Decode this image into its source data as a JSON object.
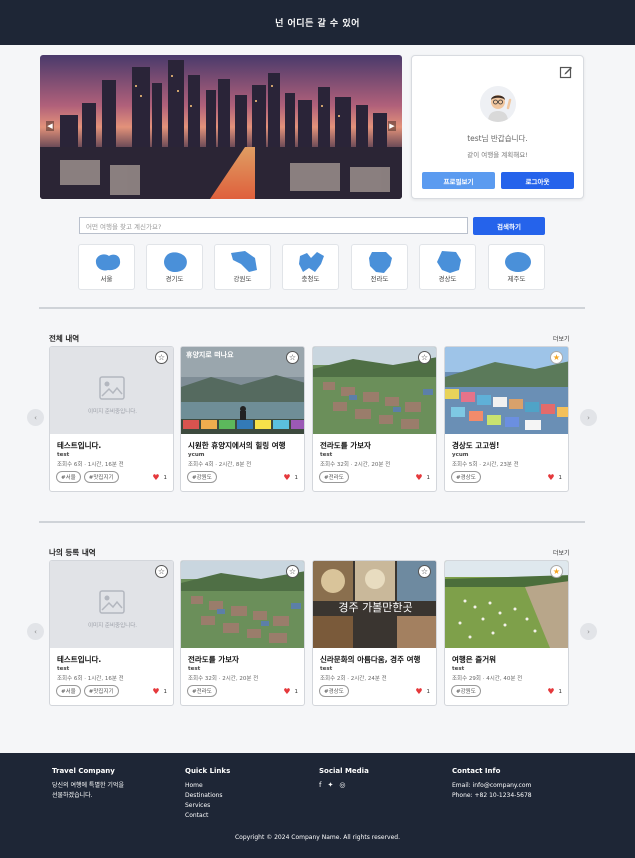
{
  "header": {
    "title": "넌 어디든 갈 수 있어"
  },
  "hero": {
    "prev_icon": "chevron-left-icon",
    "next_icon": "chevron-right-icon"
  },
  "profile": {
    "greeting": "test님 반갑습니다.",
    "subtitle": "같이 여행을 계획해요!",
    "profile_button": "프로필보기",
    "logout_button": "로그아웃",
    "edit_icon": "edit-icon"
  },
  "search": {
    "placeholder": "어떤 여행을 찾고 계신가요?",
    "button": "검색하기"
  },
  "regions": [
    {
      "name": "서울",
      "color": "#4a90d9"
    },
    {
      "name": "경기도",
      "color": "#4a90d9"
    },
    {
      "name": "강원도",
      "color": "#4a90d9"
    },
    {
      "name": "충청도",
      "color": "#4a90d9"
    },
    {
      "name": "전라도",
      "color": "#4a90d9"
    },
    {
      "name": "경상도",
      "color": "#4a90d9"
    },
    {
      "name": "제주도",
      "color": "#4a90d9"
    }
  ],
  "sections": [
    {
      "title": "전체 내역",
      "more": "더보기",
      "cards": [
        {
          "title": "테스트입니다.",
          "user": "test",
          "meta": "조회수 6회 · 1시간, 16분 전",
          "tags": [
            "#서울",
            "#맛집지기"
          ],
          "likes": "1",
          "image": "placeholder",
          "placeholder_text": "이미지 준비중입니다.",
          "favorite": false
        },
        {
          "title": "시원한 휴양지에서의 힐링 여행",
          "user": "ycum",
          "meta": "조회수 4회 · 2시간, 8분 전",
          "tags": [
            "#강원도"
          ],
          "likes": "1",
          "image": "lake",
          "overlay_text": "휴양지로 떠나요",
          "favorite": false
        },
        {
          "title": "전라도를 가보자",
          "user": "test",
          "meta": "조회수 32회 · 2시간, 20분 전",
          "tags": [
            "#전라도"
          ],
          "likes": "1",
          "image": "village",
          "favorite": false
        },
        {
          "title": "경상도 고고씽!",
          "user": "ycum",
          "meta": "조회수 5회 · 2시간, 23분 전",
          "tags": [
            "#경상도"
          ],
          "likes": "1",
          "image": "colorful",
          "favorite": true
        }
      ]
    },
    {
      "title": "나의 등록 내역",
      "more": "더보기",
      "cards": [
        {
          "title": "테스트입니다.",
          "user": "test",
          "meta": "조회수 6회 · 1시간, 16분 전",
          "tags": [
            "#서울",
            "#맛집지기"
          ],
          "likes": "1",
          "image": "placeholder",
          "placeholder_text": "이미지 준비중입니다.",
          "favorite": false
        },
        {
          "title": "전라도를 가보자",
          "user": "test",
          "meta": "조회수 32회 · 2시간, 20분 전",
          "tags": [
            "#전라도"
          ],
          "likes": "1",
          "image": "village",
          "favorite": false
        },
        {
          "title": "신라문화의 아름다움, 경주 여행",
          "user": "test",
          "meta": "조회수 2회 · 2시간, 24분 전",
          "tags": [
            "#경상도"
          ],
          "likes": "1",
          "image": "food",
          "overlay_text": "경주 가볼만한곳",
          "favorite": false
        },
        {
          "title": "여행은 즐거워",
          "user": "test",
          "meta": "조회수 29회 · 4시간, 40분 전",
          "tags": [
            "#강원도"
          ],
          "likes": "1",
          "image": "field",
          "favorite": true
        }
      ]
    }
  ],
  "footer": {
    "company": {
      "title": "Travel Company",
      "text1": "당신의 여행에 특별한 기억을",
      "text2": "선물하겠습니다."
    },
    "links": {
      "title": "Quick Links",
      "items": [
        "Home",
        "Destinations",
        "Services",
        "Contact"
      ]
    },
    "social": {
      "title": "Social Media",
      "icons": [
        "facebook-icon",
        "twitter-icon",
        "instagram-icon"
      ]
    },
    "contact": {
      "title": "Contact Info",
      "email": "Email: info@company.com",
      "phone": "Phone: +82 10-1234-5678"
    },
    "copyright": "Copyright © 2024 Company Name. All rights reserved."
  }
}
